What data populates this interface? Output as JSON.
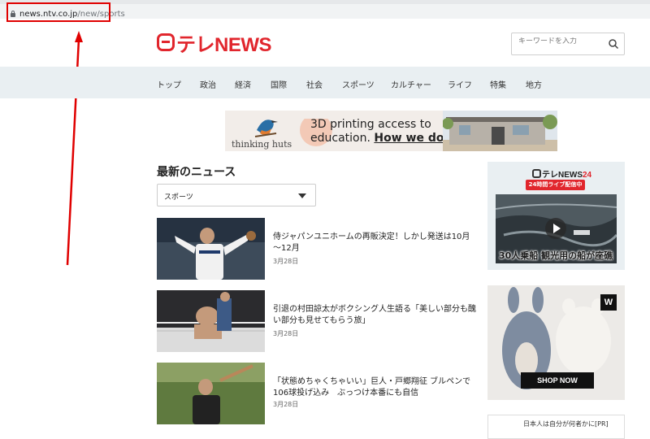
{
  "browser": {
    "url_domain": "news.ntv.co.jp",
    "url_path": "/new/sports"
  },
  "header": {
    "logo_text": "テレNEWS",
    "search_placeholder": "キーワードを入力"
  },
  "nav": {
    "items": [
      "トップ",
      "政治",
      "経済",
      "国際",
      "社会",
      "スポーツ",
      "カルチャー",
      "ライフ",
      "特集",
      "地方"
    ]
  },
  "banner_ad": {
    "brand": "thinking huts",
    "line1": "3D printing access to",
    "line2_prefix": "education.",
    "line2_link": "How we do it."
  },
  "main": {
    "section_title": "最新のニュース",
    "category_select": "スポーツ",
    "articles": [
      {
        "title": "侍ジャパンユニホームの再販決定！しかし発送は10月～12月",
        "date": "3月28日"
      },
      {
        "title": "引退の村田諒太がボクシング人生語る「美しい部分も醜い部分も見せてもらう旅」",
        "date": "3月28日"
      },
      {
        "title": "「状態めちゃくちゃいい」巨人・戸郷翔征 ブルペンで106球投げ込み　ぶっつけ本番にも自信",
        "date": "3月28日"
      }
    ]
  },
  "sidebar": {
    "live_logo": "テレNEWS",
    "live_logo_suffix": "24",
    "live_badge": "24時間ライブ配信中",
    "live_caption": "30人乗船 観光用の船が座礁",
    "ad_brand_mark": "W",
    "ad_button": "SHOP NOW",
    "bottom_text": "日本人は自分が何者かに[PR]"
  },
  "colors": {
    "brand_red": "#e1262d",
    "nav_bg": "#e9eff2",
    "annotation_red": "#e00000"
  }
}
